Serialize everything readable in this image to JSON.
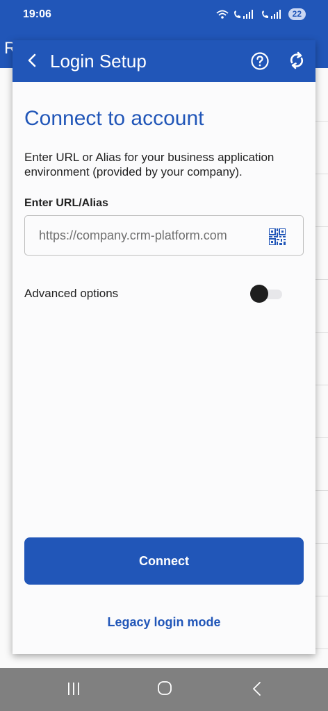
{
  "status_bar": {
    "time": "19:06",
    "battery": "22"
  },
  "background_app": {
    "title_initial": "R"
  },
  "dialog": {
    "title": "Login Setup",
    "back_icon": "chevron-left-icon",
    "help_icon": "help-circle-icon",
    "sync_icon": "sync-icon"
  },
  "content": {
    "heading": "Connect to account",
    "description": "Enter URL or Alias for your business application environment (provided by your company).",
    "url_label": "Enter URL/Alias",
    "url_placeholder": "https://company.crm-platform.com",
    "url_value": "",
    "qr_icon": "qr-code-icon",
    "advanced_label": "Advanced options",
    "advanced_enabled": false,
    "connect_label": "Connect",
    "legacy_label": "Legacy login mode"
  },
  "colors": {
    "primary": "#2156b8",
    "surface": "#fbfbfc",
    "text": "#222222"
  }
}
